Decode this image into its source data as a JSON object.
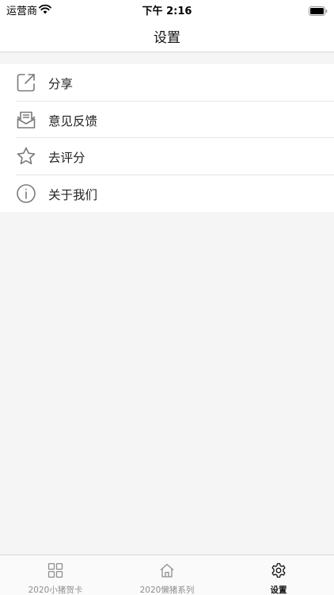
{
  "status_bar": {
    "carrier": "运营商",
    "time": "下午 2:16"
  },
  "nav": {
    "title": "设置"
  },
  "settings": {
    "items": [
      {
        "label": "分享",
        "icon": "share-icon"
      },
      {
        "label": "意见反馈",
        "icon": "feedback-mail-icon"
      },
      {
        "label": "去评分",
        "icon": "star-icon"
      },
      {
        "label": "关于我们",
        "icon": "info-icon"
      }
    ]
  },
  "tab_bar": {
    "tabs": [
      {
        "label": "2020小猪贺卡",
        "icon": "grid-icon",
        "active": false
      },
      {
        "label": "2020懒猪系列",
        "icon": "home-icon",
        "active": false
      },
      {
        "label": "设置",
        "icon": "gear-icon",
        "active": true
      }
    ]
  },
  "colors": {
    "background": "#f5f5f5",
    "surface": "#ffffff",
    "icon_gray": "#7a7a7a",
    "tab_inactive": "#8e8e8e",
    "tab_active": "#111111"
  }
}
